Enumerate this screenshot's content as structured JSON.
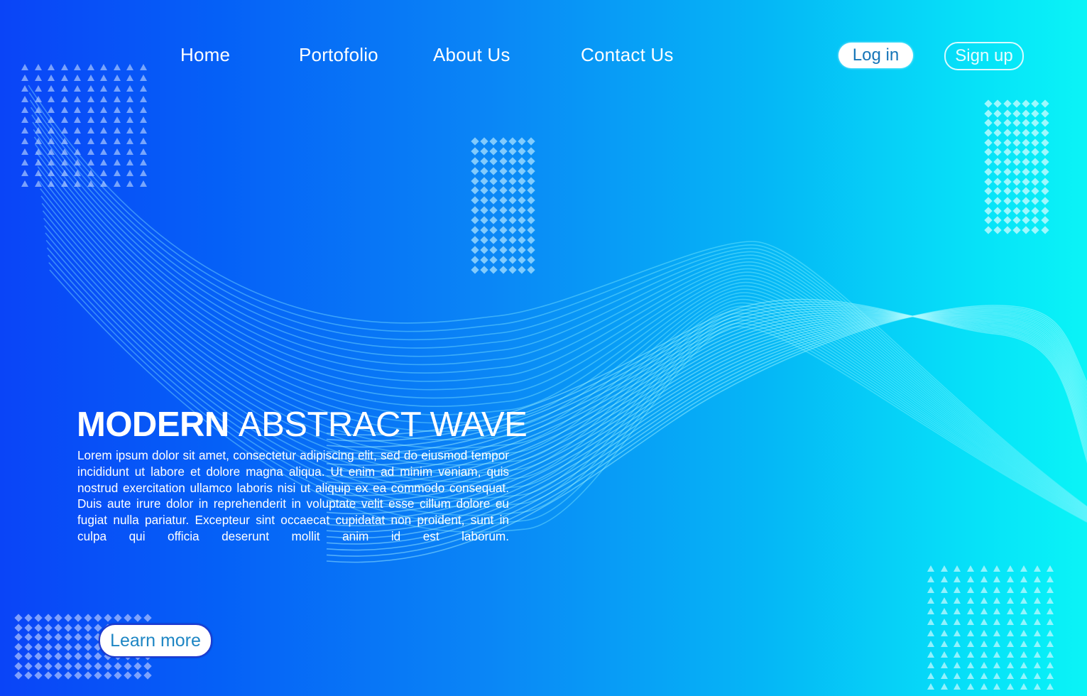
{
  "nav": {
    "items": [
      {
        "label": "Home"
      },
      {
        "label": "Portofolio"
      },
      {
        "label": "About Us"
      },
      {
        "label": "Contact Us"
      }
    ],
    "login_label": "Log in",
    "signup_label": "Sign up"
  },
  "hero": {
    "title_bold": "MODERN",
    "title_light": "ABSTRACT WAVE",
    "body": "Lorem ipsum dolor sit amet, consectetur adipiscing elit, sed do eiusmod tempor incididunt ut labore et dolore magna aliqua. Ut enim ad minim veniam, quis nostrud exercitation ullamco laboris nisi ut aliquip ex ea commodo consequat. Duis aute irure dolor in reprehenderit in voluptate velit esse cillum dolore eu fugiat nulla pariatur. Excepteur sint occaecat cupidatat non proident, sunt in culpa qui officia deserunt mollit anim id est laborum.",
    "cta_label": "Learn more"
  },
  "decor": {
    "patterns": [
      {
        "name": "top-left",
        "shape": "triangle",
        "cols": 10,
        "rows": 12
      },
      {
        "name": "middle",
        "shape": "diamond",
        "cols": 7,
        "rows": 14
      },
      {
        "name": "top-right",
        "shape": "diamond",
        "cols": 7,
        "rows": 14
      },
      {
        "name": "bottom-right",
        "shape": "triangle",
        "cols": 10,
        "rows": 12
      },
      {
        "name": "bottom-left",
        "shape": "diamond",
        "cols": 14,
        "rows": 7
      }
    ]
  },
  "colors": {
    "gradient_start": "#0a44f7",
    "gradient_end": "#0af4f7",
    "text": "#ffffff",
    "login_text": "#1675b8",
    "learn_more_text": "#1e86c4",
    "learn_more_border": "#1f3ad0"
  }
}
